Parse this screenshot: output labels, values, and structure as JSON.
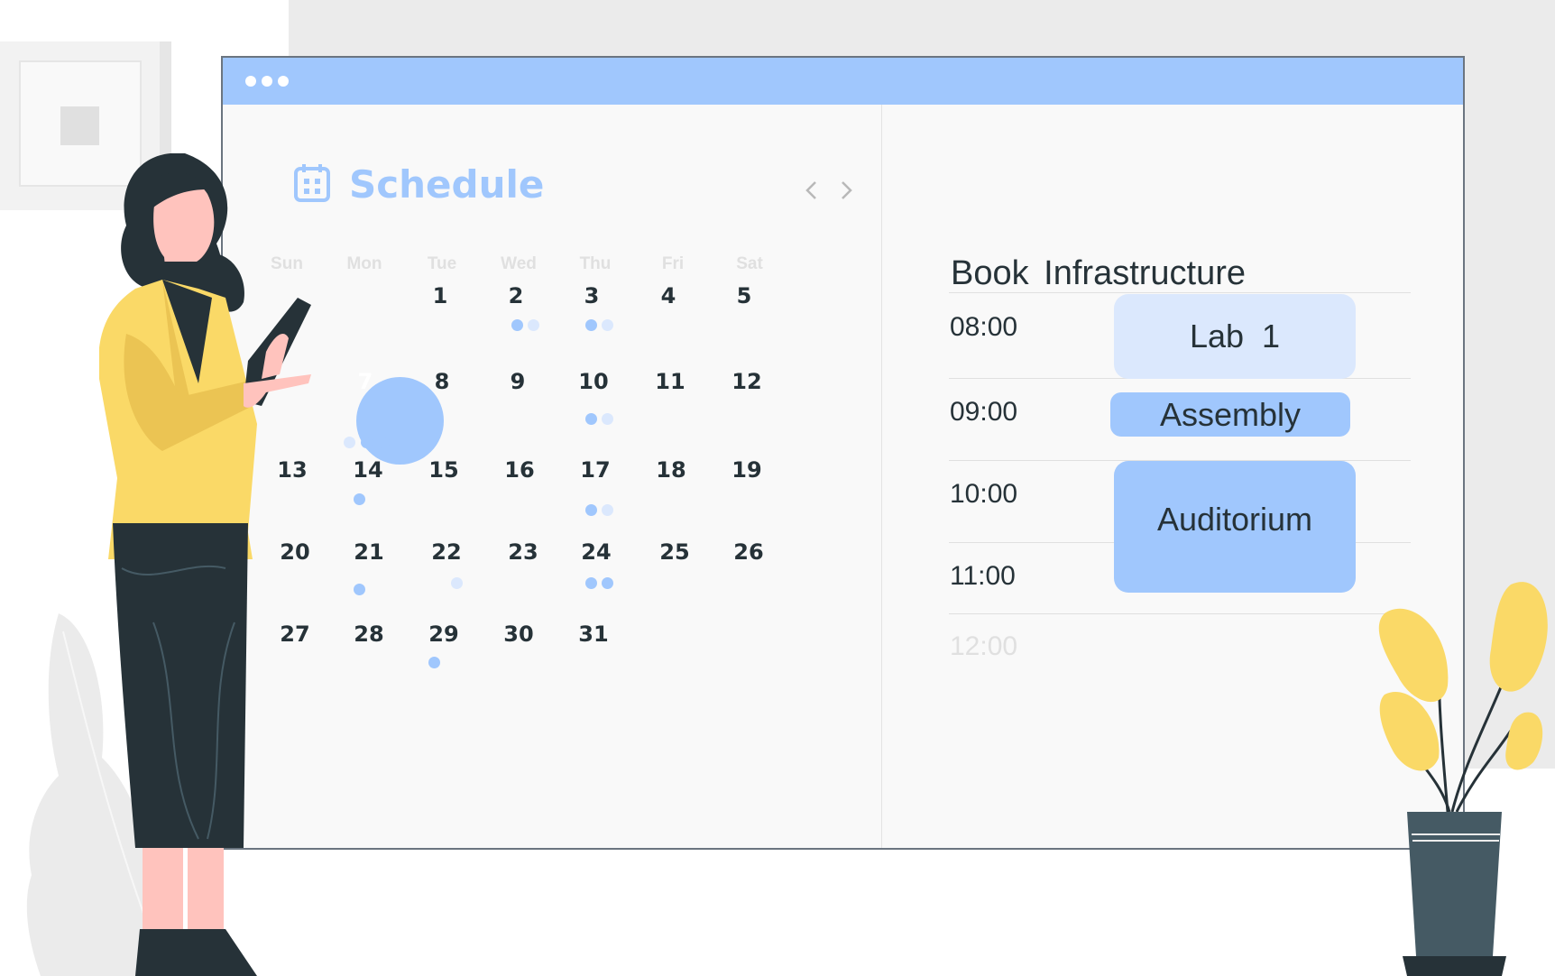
{
  "colors": {
    "accent": "#a0c7fd",
    "accent_light": "#dbe8fd",
    "text": "#263238",
    "muted": "#e0e0e0",
    "plant": "#fad967",
    "jacket": "#fad967"
  },
  "window": {
    "icon": "calendar-icon",
    "dots": [
      "dot",
      "dot",
      "dot"
    ]
  },
  "schedule": {
    "title": "Schedule",
    "weekdays": [
      "Sun",
      "Mon",
      "Tue",
      "Wed",
      "Thu",
      "Fri",
      "Sat"
    ],
    "selected_day": "7",
    "rows": [
      [
        "",
        "",
        "1",
        "2",
        "3",
        "4",
        "5"
      ],
      [
        "",
        "7",
        "8",
        "9",
        "10",
        "11",
        "12"
      ],
      [
        "13",
        "14",
        "15",
        "16",
        "17",
        "18",
        "19"
      ],
      [
        "20",
        "21",
        "22",
        "23",
        "24",
        "25",
        "26"
      ],
      [
        "27",
        "28",
        "29",
        "30",
        "31",
        "",
        ""
      ]
    ]
  },
  "booking": {
    "title": "Book  Infrastructure",
    "times": [
      "08:00",
      "09:00",
      "10:00",
      "11:00",
      "12:00"
    ],
    "slots": [
      {
        "label": "Lab  1"
      },
      {
        "label": "Assembly"
      },
      {
        "label": "Auditorium"
      }
    ]
  }
}
